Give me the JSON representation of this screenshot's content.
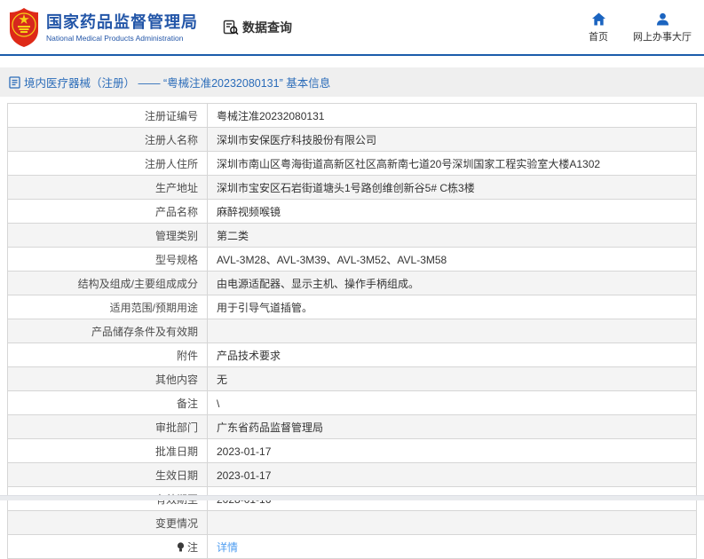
{
  "header": {
    "org_name_zh": "国家药品监督管理局",
    "org_name_en": "National Medical Products Administration",
    "data_query_label": "数据查询",
    "nav": [
      {
        "label": "首页",
        "icon": "home-icon"
      },
      {
        "label": "网上办事大厅",
        "icon": "user-icon"
      }
    ]
  },
  "breadcrumb": {
    "title": "境内医疗器械（注册） ——  “粤械注准20232080131”  基本信息"
  },
  "table": {
    "rows": [
      {
        "label": "注册证编号",
        "value": "粤械注准20232080131"
      },
      {
        "label": "注册人名称",
        "value": "深圳市安保医疗科技股份有限公司"
      },
      {
        "label": "注册人住所",
        "value": "深圳市南山区粤海街道高新区社区高新南七道20号深圳国家工程实验室大楼A1302"
      },
      {
        "label": "生产地址",
        "value": "深圳市宝安区石岩街道塘头1号路创维创新谷5# C栋3楼"
      },
      {
        "label": "产品名称",
        "value": "麻醉视频喉镜"
      },
      {
        "label": "管理类别",
        "value": "第二类"
      },
      {
        "label": "型号规格",
        "value": "AVL-3M28、AVL-3M39、AVL-3M52、AVL-3M58"
      },
      {
        "label": "结构及组成/主要组成成分",
        "value": "由电源适配器、显示主机、操作手柄组成。"
      },
      {
        "label": "适用范围/预期用途",
        "value": "用于引导气道插管。"
      },
      {
        "label": "产品储存条件及有效期",
        "value": ""
      },
      {
        "label": "附件",
        "value": "产品技术要求"
      },
      {
        "label": "其他内容",
        "value": "无"
      },
      {
        "label": "备注",
        "value": "\\"
      },
      {
        "label": "审批部门",
        "value": "广东省药品监督管理局"
      },
      {
        "label": "批准日期",
        "value": "2023-01-17"
      },
      {
        "label": "生效日期",
        "value": "2023-01-17"
      },
      {
        "label": "有效期至",
        "value": "2028-01-16"
      },
      {
        "label": "变更情况",
        "value": ""
      },
      {
        "label": "注",
        "icon": "note-icon",
        "value": "详情",
        "type": "link"
      }
    ]
  },
  "colors": {
    "brand_blue": "#2356a8",
    "header_rule": "#1b5cab",
    "nav_icon_blue": "#1b64c0",
    "title_bar_bg": "#efefef",
    "title_text": "#2b6cb9",
    "table_border": "#d6d6d6",
    "zebra_gray": "#f4f4f4",
    "link_blue": "#4e9cf0",
    "emblem_red": "#de2a18",
    "emblem_gold": "#f7d117"
  }
}
